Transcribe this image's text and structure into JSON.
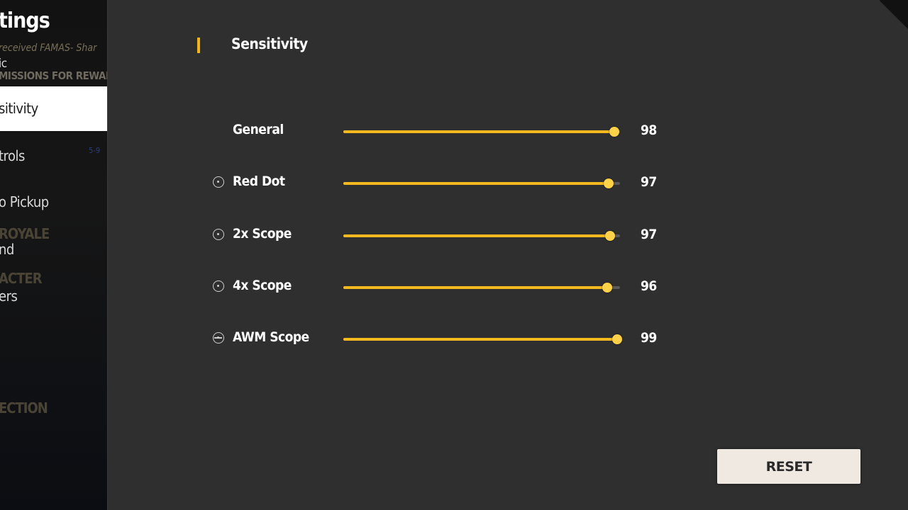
{
  "sidebar": {
    "title": "tings",
    "ticker": "received FAMAS- Shar",
    "ticker_line2": "ic",
    "missions_banner": "MISSIONS FOR REWARDS",
    "items": [
      {
        "label": "sitivity",
        "active": true
      },
      {
        "label": "trols"
      },
      {
        "label": "o Pickup"
      },
      {
        "label": "nd"
      },
      {
        "label": "ers"
      }
    ],
    "bg_labels": [
      "ROYALE",
      "ACTER",
      "ECTION"
    ],
    "small_tag": "5-9"
  },
  "section": {
    "title": "Sensitivity",
    "accent_color": "#f2b51c"
  },
  "sliders": [
    {
      "label": "General",
      "icon": null,
      "value": "98",
      "level": 0.98
    },
    {
      "label": "Red Dot",
      "icon": "red-dot-icon",
      "value": "97",
      "level": 0.96
    },
    {
      "label": "2x Scope",
      "icon": "2x-scope-icon",
      "value": "97",
      "level": 0.965
    },
    {
      "label": "4x Scope",
      "icon": "4x-scope-icon",
      "value": "96",
      "level": 0.955
    },
    {
      "label": "AWM Scope",
      "icon": "awm-scope-icon",
      "value": "99",
      "level": 0.99
    }
  ],
  "reset_button": {
    "label": "RESET"
  },
  "colors": {
    "background": "#2f2f2f",
    "slider_fill": "#f3b91f",
    "knob": "#ffd24a",
    "button_bg": "#efe9e1"
  }
}
